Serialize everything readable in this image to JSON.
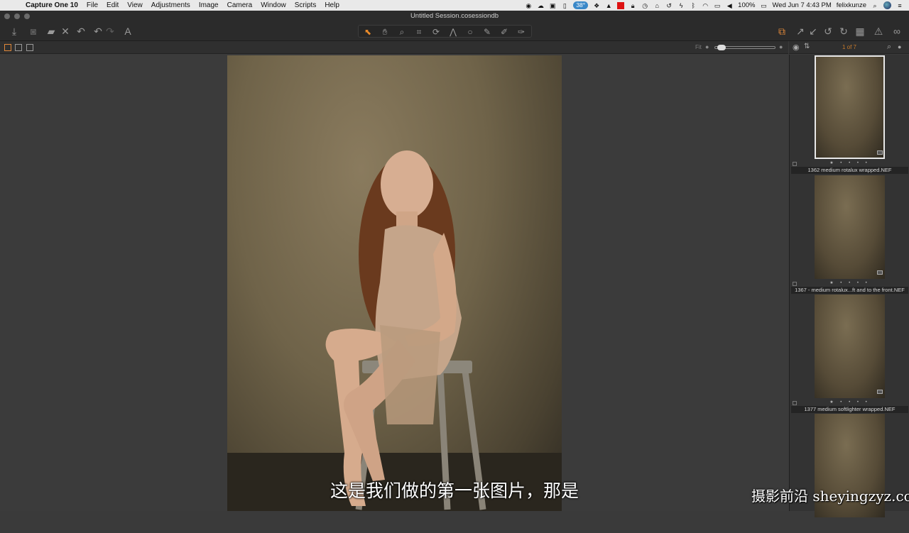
{
  "menubar": {
    "apple_icon": "apple-icon",
    "items": [
      "Capture One 10",
      "File",
      "Edit",
      "View",
      "Adjustments",
      "Image",
      "Camera",
      "Window",
      "Scripts",
      "Help"
    ],
    "temperature": "38°",
    "battery": "100%",
    "datetime": "Wed Jun 7  4:43 PM",
    "user": "felixkunze"
  },
  "window": {
    "title": "Untitled Session.cosessiondb"
  },
  "toolbar": {
    "left_icons": [
      "import-icon",
      "camera-icon",
      "move-to-icon",
      "delete-icon",
      "undo-icon",
      "rotate-left-icon",
      "rotate-right-icon",
      "text-icon"
    ],
    "cursor_tools": [
      "select-tool",
      "pan-tool",
      "loupe-tool",
      "crop-tool",
      "rotate-tool",
      "keystone-tool",
      "spot-tool",
      "brush-tool",
      "picker-tool",
      "annotate-tool"
    ],
    "right_icons": [
      "capture-icon",
      "apply-icon",
      "copy-icon",
      "rotate-ccw-icon",
      "rotate-cw-icon",
      "grid-icon",
      "warning-icon",
      "proof-icon"
    ]
  },
  "viewer": {
    "fit_label": "Fit",
    "zoom_level": 0.05
  },
  "filmstrip": {
    "counter": "1 of 7",
    "thumbs": [
      {
        "name": "1362 medium rotalux wrapped.NEF",
        "stars": "★ • • • •",
        "selected": true
      },
      {
        "name": "1367 - medium rotalux...ft and to the front.NEF",
        "stars": "★ • • • •",
        "selected": false
      },
      {
        "name": "1377 medium softlighter wrapped.NEF",
        "stars": "★ • • • •",
        "selected": false
      },
      {
        "name": "",
        "stars": "",
        "selected": false
      }
    ]
  },
  "subtitle": "这是我们做的第一张图片，那是",
  "watermark": "摄影前沿 sheyingzyz.com"
}
